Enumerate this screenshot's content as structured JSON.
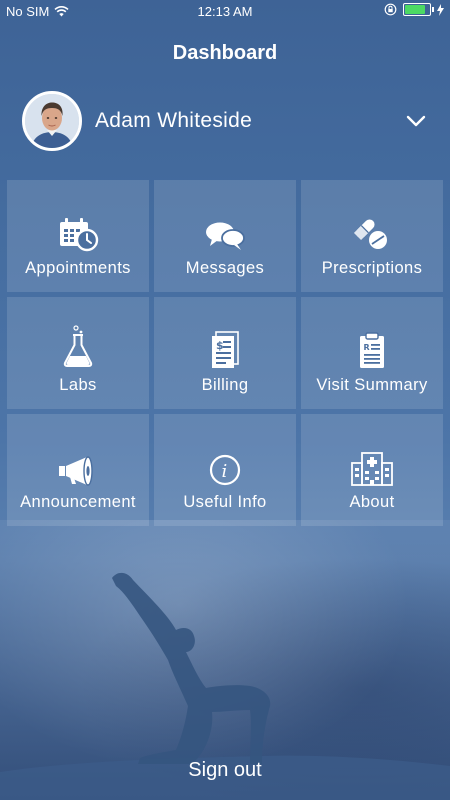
{
  "status_bar": {
    "carrier": "No SIM",
    "time": "12:13 AM",
    "battery_level": 0.75
  },
  "header": {
    "title": "Dashboard"
  },
  "profile": {
    "name": "Adam Whiteside"
  },
  "tiles": [
    {
      "label": "Appointments",
      "icon": "calendar-clock-icon"
    },
    {
      "label": "Messages",
      "icon": "chat-bubbles-icon"
    },
    {
      "label": "Prescriptions",
      "icon": "pills-icon"
    },
    {
      "label": "Labs",
      "icon": "flask-icon"
    },
    {
      "label": "Billing",
      "icon": "bill-icon"
    },
    {
      "label": "Visit Summary",
      "icon": "clipboard-icon"
    },
    {
      "label": "Announcement",
      "icon": "megaphone-icon"
    },
    {
      "label": "Useful Info",
      "icon": "info-icon"
    },
    {
      "label": "About",
      "icon": "hospital-icon"
    }
  ],
  "footer": {
    "signout_label": "Sign out"
  },
  "colors": {
    "background": "#4a70a3",
    "battery": "#4cd964",
    "tile": "rgba(255,255,255,0.13)"
  }
}
